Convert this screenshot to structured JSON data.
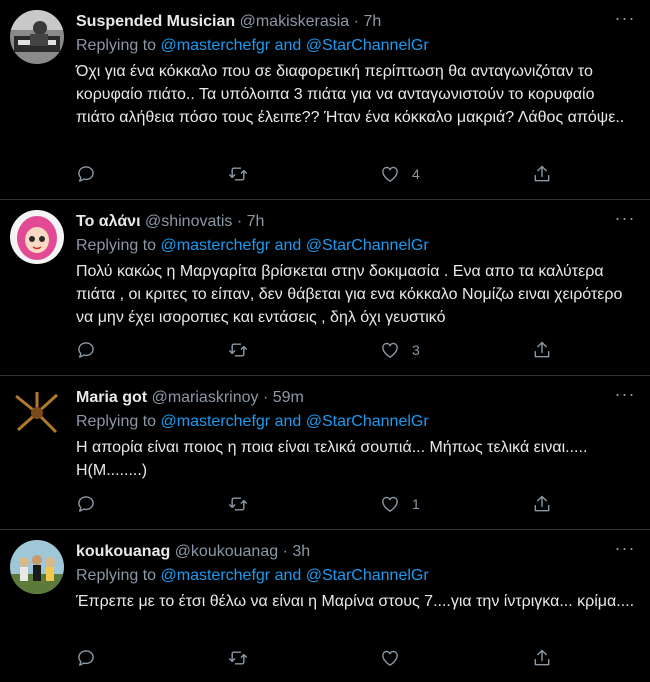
{
  "tweets": [
    {
      "name": "Suspended Musician",
      "handle": "@makiskerasia",
      "time": "7h",
      "reply_prefix": "Replying to",
      "mention1": "@masterchefgr",
      "and_text": "and",
      "mention2": "@StarChannelGr",
      "text": "Όχι για ένα κόκκαλο που σε διαφορετική περίπτωση θα ανταγωνιζόταν το κορυφαίο πιάτο.. Τα υπόλοιπα 3 πιάτα για να ανταγωνιστούν το κορυφαίο πιάτο αλήθεια πόσο τους έλειπε?? Ήταν ένα κόκκαλο μακριά? Λάθος απόψε..",
      "likes": "4"
    },
    {
      "name": "Το αλάνι",
      "handle": "@shinovatis",
      "time": "7h",
      "reply_prefix": "Replying to",
      "mention1": "@masterchefgr",
      "and_text": "and",
      "mention2": "@StarChannelGr",
      "text": "Πολύ κακώς η Μαργαρίτα βρίσκεται στην δοκιμασία . Ενα απο τα καλύτερα πιάτα , οι κριτες το είπαν, δεν θάβεται για ενα κόκκαλο Νομίζω ειναι χειρότερο να μην έχει ισοροπιες και εντάσεις , δηλ όχι γευστικό",
      "likes": "3"
    },
    {
      "name": "Maria got",
      "handle": "@mariaskrinoy",
      "time": "59m",
      "reply_prefix": "Replying to",
      "mention1": "@masterchefgr",
      "and_text": "and",
      "mention2": "@StarChannelGr",
      "text": "Η απορία είναι ποιος η ποια είναι τελικά σουπιά... Μήπως τελικά ειναι..... Η(Μ........)",
      "likes": "1"
    },
    {
      "name": "koukouanag",
      "handle": "@koukouanag",
      "time": "3h",
      "reply_prefix": "Replying to",
      "mention1": "@masterchefgr",
      "and_text": "and",
      "mention2": "@StarChannelGr",
      "text": "Έπρεπε με το έτσι θέλω να είναι η Μαρίνα στους 7....για την ίντριγκα... κρίμα....",
      "likes": ""
    }
  ],
  "separator": "·",
  "icons": {
    "more": "more-horizontal-icon",
    "reply": "reply-bubble-icon",
    "retweet": "retweet-icon",
    "like": "heart-icon",
    "share": "share-icon"
  },
  "colors": {
    "background": "#000000",
    "text": "#e7e9ea",
    "secondary": "#8b98a5",
    "link": "#1d9bf0",
    "border": "#2f3336"
  }
}
